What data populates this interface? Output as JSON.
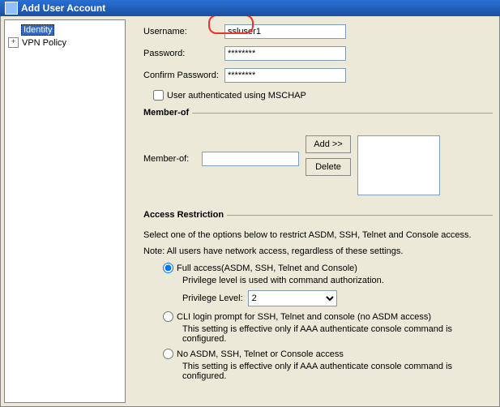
{
  "title": "Add User Account",
  "tree": {
    "identity": "Identity",
    "vpn_policy": "VPN Policy"
  },
  "form": {
    "username_label": "Username:",
    "username_value": "ssluser1",
    "password_label": "Password:",
    "password_value": "********",
    "confirm_label": "Confirm Password:",
    "confirm_value": "********",
    "mschap_label": "User authenticated using MSCHAP"
  },
  "member": {
    "legend": "Member-of",
    "label": "Member-of:",
    "value": "",
    "add_btn": "Add >>",
    "delete_btn": "Delete"
  },
  "access": {
    "legend": "Access Restriction",
    "desc1": "Select one of the options below to restrict ASDM, SSH, Telnet and Console access.",
    "desc2": "Note: All users have network access, regardless of these settings.",
    "opt1": "Full access(ASDM, SSH, Telnet and Console)",
    "opt1_note": "Privilege level is used with command authorization.",
    "priv_label": "Privilege Level:",
    "priv_value": "2",
    "opt2": "CLI login prompt for SSH, Telnet and console (no ASDM access)",
    "opt2_note": "This setting is effective only if AAA authenticate console command is configured.",
    "opt3": "No ASDM, SSH, Telnet or Console access",
    "opt3_note": "This setting is effective only if AAA authenticate console command is configured."
  }
}
